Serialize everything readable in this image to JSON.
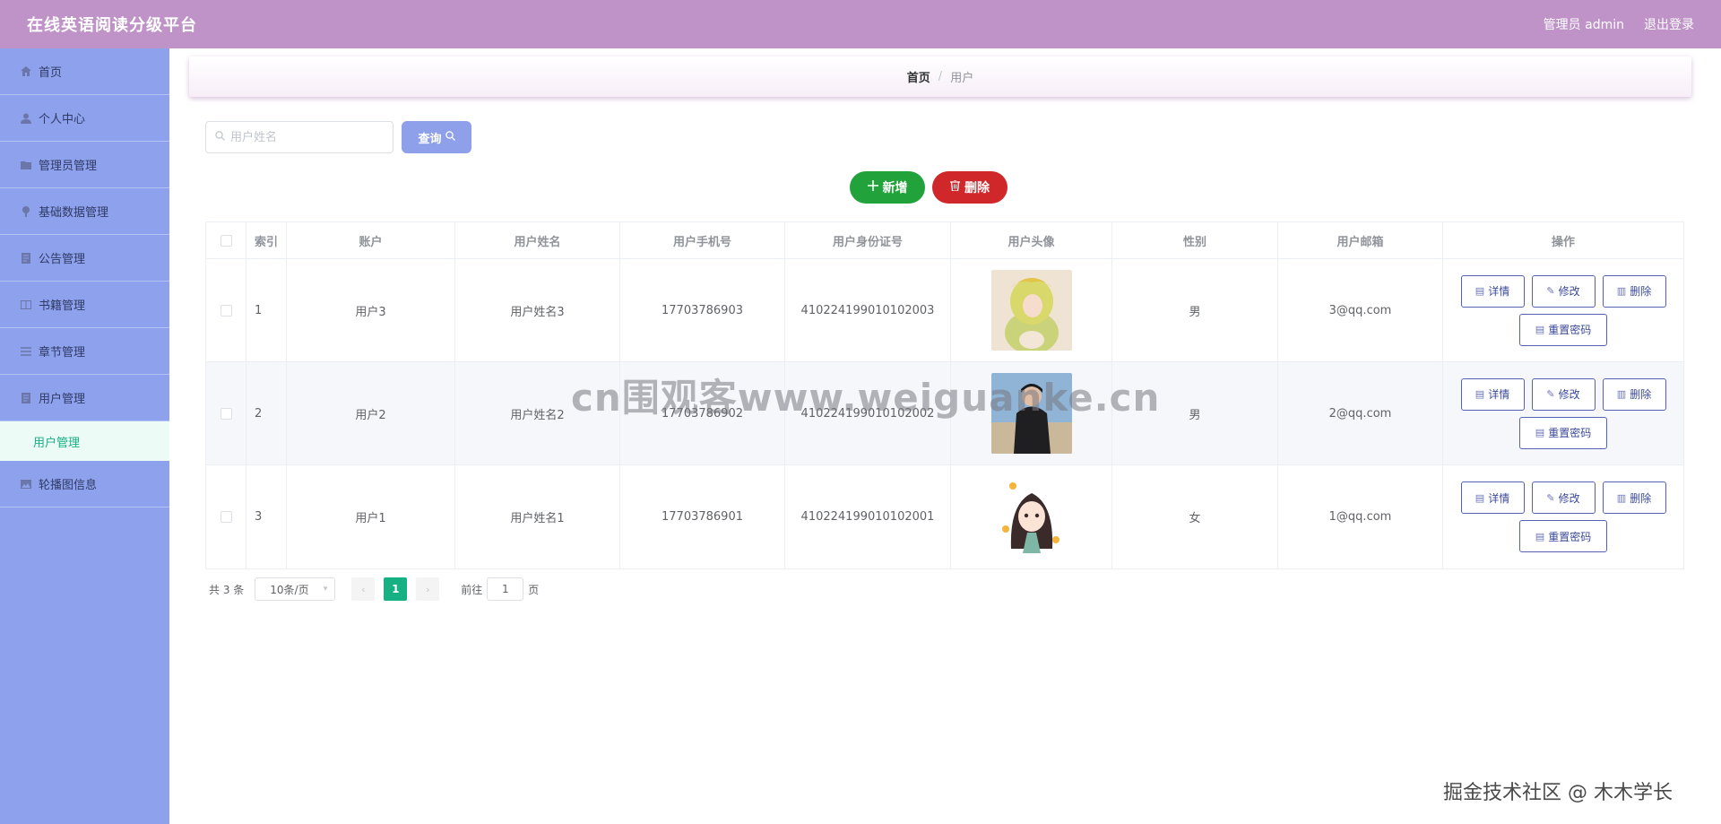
{
  "header": {
    "title": "在线英语阅读分级平台",
    "admin_label": "管理员 admin",
    "logout_label": "退出登录"
  },
  "sidebar": {
    "items": [
      {
        "label": "首页",
        "icon": "home-icon"
      },
      {
        "label": "个人中心",
        "icon": "user-icon"
      },
      {
        "label": "管理员管理",
        "icon": "folder-icon"
      },
      {
        "label": "基础数据管理",
        "icon": "pin-icon"
      },
      {
        "label": "公告管理",
        "icon": "document-icon"
      },
      {
        "label": "书籍管理",
        "icon": "book-icon"
      },
      {
        "label": "章节管理",
        "icon": "list-icon"
      },
      {
        "label": "用户管理",
        "icon": "document-icon"
      }
    ],
    "active_sub": "用户管理",
    "last_item": {
      "label": "轮播图信息",
      "icon": "image-icon"
    }
  },
  "breadcrumb": {
    "home": "首页",
    "separator": "/",
    "current": "用户"
  },
  "search": {
    "placeholder": "用户姓名",
    "value": "",
    "query_label": "查询"
  },
  "actions": {
    "add_label": "新增",
    "delete_label": "删除"
  },
  "table": {
    "headers": [
      "索引",
      "账户",
      "用户姓名",
      "用户手机号",
      "用户身份证号",
      "用户头像",
      "性别",
      "用户邮箱",
      "操作"
    ],
    "rows": [
      {
        "index": "1",
        "account": "用户3",
        "name": "用户姓名3",
        "phone": "17703786903",
        "id_card": "410224199010102003",
        "avatar": "avatar-anime-girl-yellow",
        "gender": "男",
        "email": "3@qq.com"
      },
      {
        "index": "2",
        "account": "用户2",
        "name": "用户姓名2",
        "phone": "17703786902",
        "id_card": "410224199010102002",
        "avatar": "avatar-photo-man",
        "gender": "男",
        "email": "2@qq.com"
      },
      {
        "index": "3",
        "account": "用户1",
        "name": "用户姓名1",
        "phone": "17703786901",
        "id_card": "410224199010102001",
        "avatar": "avatar-cartoon-girl",
        "gender": "女",
        "email": "1@qq.com"
      }
    ],
    "op_labels": {
      "detail": "详情",
      "edit": "修改",
      "delete": "删除",
      "reset_password": "重置密码"
    }
  },
  "pagination": {
    "total_text": "共 3 条",
    "page_size": "10条/页",
    "current_page": "1",
    "goto_label": "前往",
    "goto_value": "1",
    "page_suffix": "页"
  },
  "watermarks": {
    "center": "cn围观客www.weiguanke.cn",
    "bottom_right": "掘金技术社区 @ 木木学长"
  },
  "colors": {
    "header_bg": "#bf93c8",
    "sidebar_bg": "#8da1ec",
    "accent_green": "#16b083",
    "add_button": "#22a23a",
    "delete_button": "#d0272b",
    "query_button": "#8fa0ea"
  }
}
